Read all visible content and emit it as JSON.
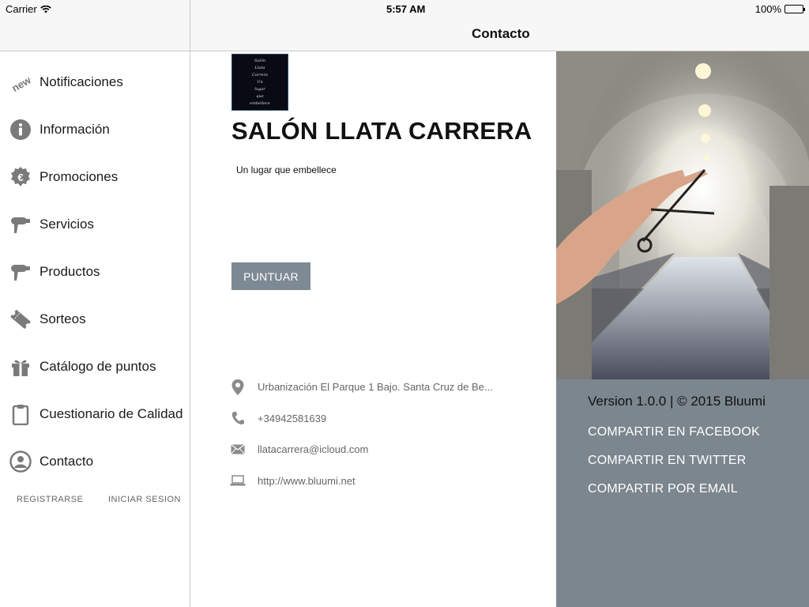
{
  "status_bar": {
    "carrier": "Carrier",
    "time": "5:57 AM",
    "battery": "100%"
  },
  "header": {
    "title": "Contacto"
  },
  "sidebar": {
    "items": [
      {
        "label": "Notificaciones",
        "icon": "new-badge-icon"
      },
      {
        "label": "Información",
        "icon": "info-icon"
      },
      {
        "label": "Promociones",
        "icon": "euro-badge-icon"
      },
      {
        "label": "Servicios",
        "icon": "hair-dryer-icon"
      },
      {
        "label": "Productos",
        "icon": "hair-dryer-icon"
      },
      {
        "label": "Sorteos",
        "icon": "ticket-icon"
      },
      {
        "label": "Catálogo de puntos",
        "icon": "gift-icon"
      },
      {
        "label": "Cuestionario de Calidad",
        "icon": "clipboard-icon"
      },
      {
        "label": "Contacto",
        "icon": "contact-icon"
      }
    ],
    "register_label": "REGISTRARSE",
    "login_label": "INICIAR SESION"
  },
  "business": {
    "name": "SALÓN LLATA CARRERA",
    "tagline": "Un lugar que embellece",
    "rate_button": "PUNTUAR",
    "logo_lines": [
      "Salón",
      "Llata",
      "Carrera",
      "Un",
      "lugar",
      "que",
      "embellece"
    ]
  },
  "contact": {
    "address": "Urbanización El Parque 1 Bajo. Santa Cruz de Be...",
    "phone": "+34942581639",
    "email": "llatacarrera@icloud.com",
    "website": "http://www.bluumi.net"
  },
  "footer": {
    "version": "Version 1.0.0 | © 2015 Bluumi",
    "share_facebook": "COMPARTIR EN FACEBOOK",
    "share_twitter": "COMPARTIR EN TWITTER",
    "share_email": "COMPARTIR POR EMAIL"
  },
  "colors": {
    "accent_gray": "#7b868e",
    "button": "#7d8a93"
  }
}
